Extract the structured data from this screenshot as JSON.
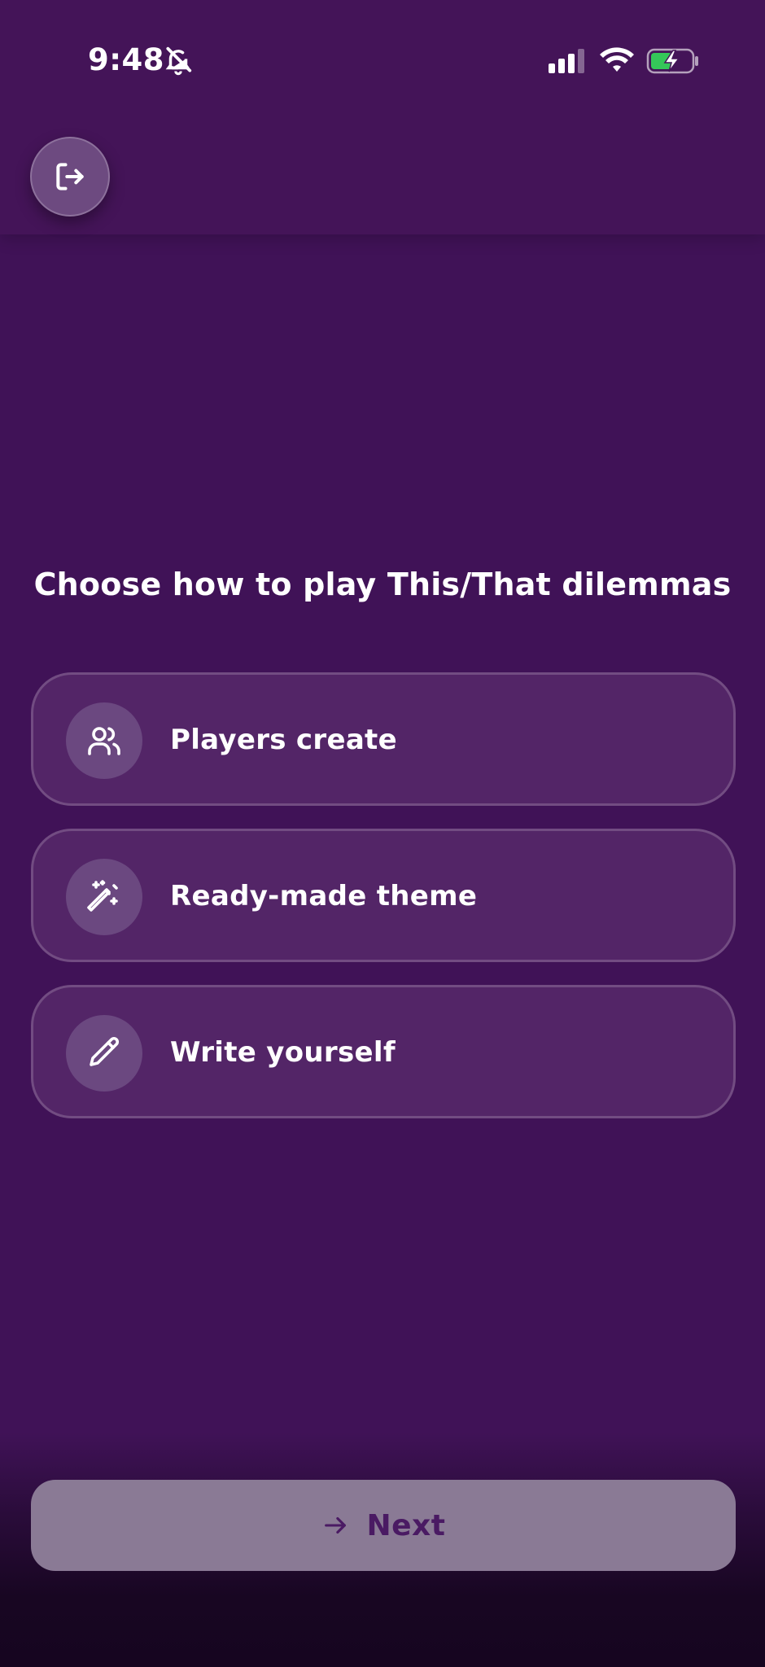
{
  "status_bar": {
    "time": "9:48",
    "icons": [
      "bell-slash-icon",
      "cellular-signal-icon",
      "wifi-icon",
      "battery-charging-icon"
    ]
  },
  "header": {
    "exit_icon": "exit-icon"
  },
  "main": {
    "title": "Choose how to play This/That dilemmas",
    "options": [
      {
        "label": "Players create",
        "icon": "users-icon"
      },
      {
        "label": "Ready-made theme",
        "icon": "magic-wand-icon"
      },
      {
        "label": "Write yourself",
        "icon": "pencil-icon"
      }
    ]
  },
  "footer": {
    "next_label": "Next",
    "next_icon": "arrow-right-icon"
  },
  "colors": {
    "background": "#401257",
    "header": "#441458",
    "card": "#532567",
    "icon_circle": "#6b4880",
    "next_button": "#8a7a95",
    "next_text": "#4a1a63"
  }
}
